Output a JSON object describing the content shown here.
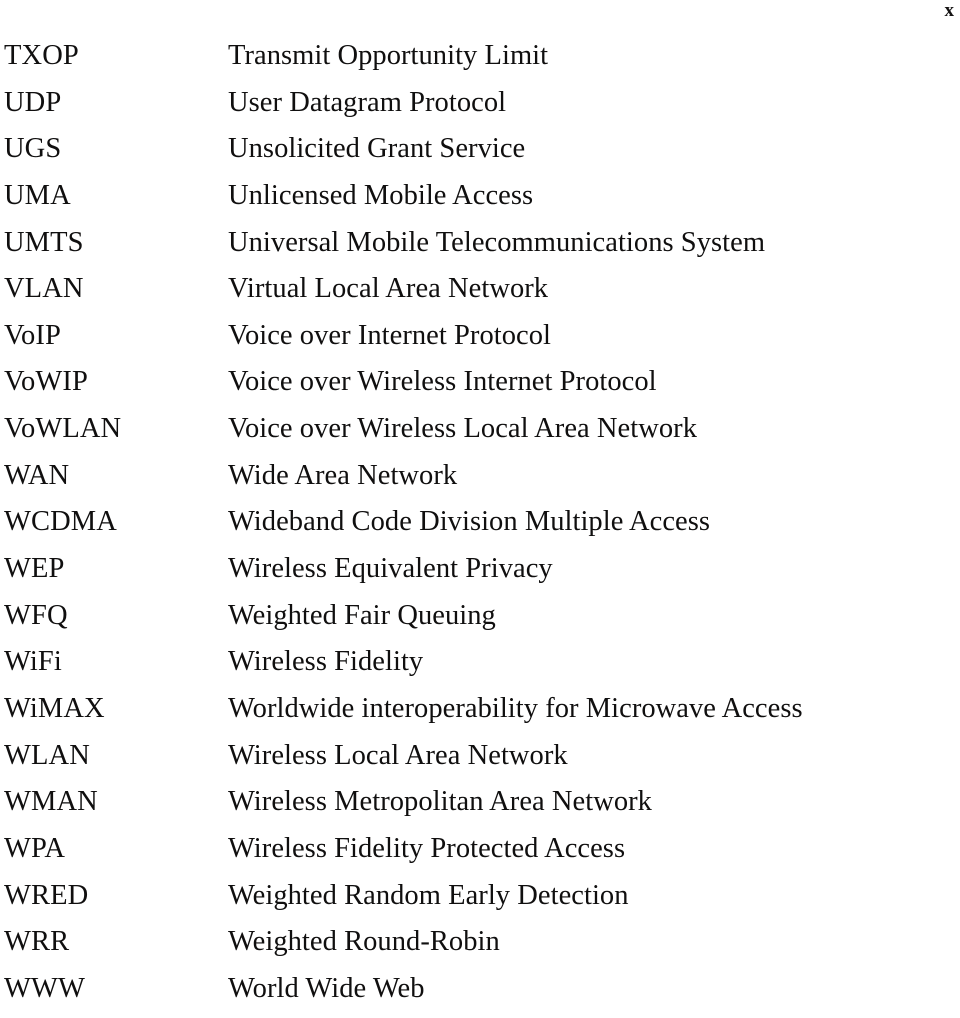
{
  "page": {
    "folio": "x",
    "background_color": "#ffffff",
    "text_color": "#100f0f"
  },
  "glossary": {
    "entries": [
      {
        "term": "TXOP",
        "definition": "Transmit Opportunity Limit"
      },
      {
        "term": "UDP",
        "definition": "User Datagram Protocol"
      },
      {
        "term": "UGS",
        "definition": "Unsolicited Grant Service"
      },
      {
        "term": "UMA",
        "definition": "Unlicensed Mobile Access"
      },
      {
        "term": "UMTS",
        "definition": "Universal Mobile Telecommunications System"
      },
      {
        "term": "VLAN",
        "definition": "Virtual Local Area Network"
      },
      {
        "term": "VoIP",
        "definition": "Voice over Internet Protocol"
      },
      {
        "term": "VoWIP",
        "definition": "Voice over Wireless Internet Protocol"
      },
      {
        "term": "VoWLAN",
        "definition": "Voice over Wireless Local Area Network"
      },
      {
        "term": "WAN",
        "definition": "Wide Area Network"
      },
      {
        "term": "WCDMA",
        "definition": "Wideband Code Division Multiple Access"
      },
      {
        "term": "WEP",
        "definition": "Wireless Equivalent Privacy"
      },
      {
        "term": "WFQ",
        "definition": "Weighted Fair Queuing"
      },
      {
        "term": "WiFi",
        "definition": "Wireless Fidelity"
      },
      {
        "term": "WiMAX",
        "definition": "Worldwide interoperability for Microwave Access"
      },
      {
        "term": "WLAN",
        "definition": "Wireless Local Area Network"
      },
      {
        "term": "WMAN",
        "definition": "Wireless Metropolitan Area Network"
      },
      {
        "term": "WPA",
        "definition": "Wireless Fidelity Protected Access"
      },
      {
        "term": "WRED",
        "definition": "Weighted Random Early Detection"
      },
      {
        "term": "WRR",
        "definition": "Weighted Round-Robin"
      },
      {
        "term": "WWW",
        "definition": "World Wide Web"
      }
    ]
  }
}
